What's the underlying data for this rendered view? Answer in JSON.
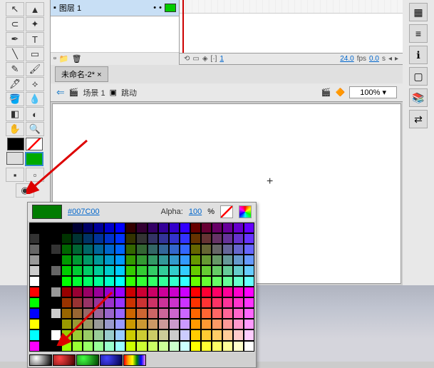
{
  "layer": {
    "name": "图层 1"
  },
  "timeline": {
    "fps": "24.0",
    "fpslabel": "fps",
    "time": "0.0",
    "timelabel": "s",
    "frame": "1"
  },
  "tab": {
    "name": "未命名-2*",
    "close": "×"
  },
  "scene": {
    "back": "⇐",
    "icon": "🎬",
    "name": "场景 1",
    "symIcon": "▣",
    "symName": "跳动"
  },
  "zoom": {
    "value": "100%"
  },
  "stage": {
    "cursor": "+"
  },
  "picker": {
    "hex": "#007C00",
    "alphaLabel": "Alpha:",
    "alphaVal": "100",
    "pct": "%"
  },
  "tools": {
    "stroke": "#000000",
    "fill": "#00aa00",
    "nofill": "nofill"
  },
  "icons": {
    "arrow": "↖",
    "sub": "▲",
    "lasso": "⊂",
    "wand": "✦",
    "pen": "✒",
    "text": "T",
    "line": "╲",
    "rect": "▭",
    "pencil": "✎",
    "brush": "🖌",
    "ink": "🖋",
    "bone": "⟡",
    "bucket": "🪣",
    "drop": "💧",
    "erase": "◧",
    "trans": "◐",
    "hand": "✋",
    "zoom": "🔍",
    "grid": "▦",
    "align": "≡",
    "info": "ℹ",
    "lib": "📚",
    "swap": "⇄",
    "transform": "▢"
  }
}
